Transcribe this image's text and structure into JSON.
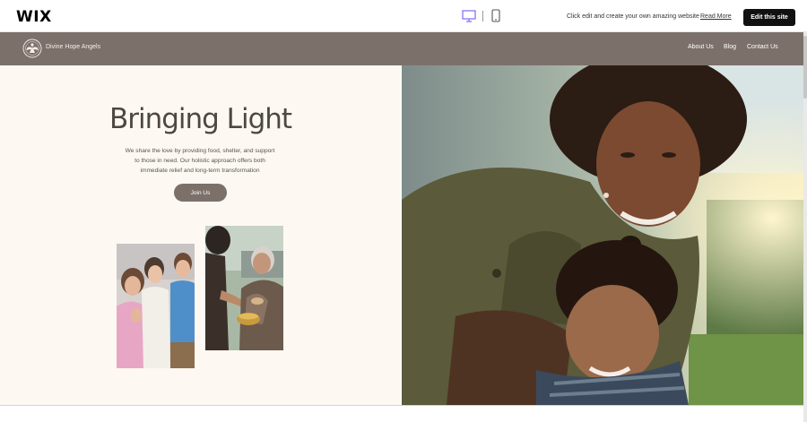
{
  "editor_bar": {
    "logo": "WIX",
    "device_desktop_icon": "desktop-icon",
    "device_mobile_icon": "mobile-icon",
    "promo_text": "Click edit and create your own amazing website",
    "read_more": "Read More",
    "edit_button": "Edit this site"
  },
  "site": {
    "logo_icon": "angel-emblem-icon",
    "name": "Divine Hope Angels",
    "nav": [
      "About Us",
      "Blog",
      "Contact Us"
    ]
  },
  "hero": {
    "title": "Bringing Light",
    "description": "We share the love by providing food, shelter, and support to those in need. Our holistic approach offers both immediate relief and long-term transformation",
    "cta": "Join Us"
  },
  "colors": {
    "header_bg": "#7c706a",
    "hero_bg": "#fdf8f2",
    "button_bg": "#7c706a",
    "edit_button_bg": "#111111"
  }
}
